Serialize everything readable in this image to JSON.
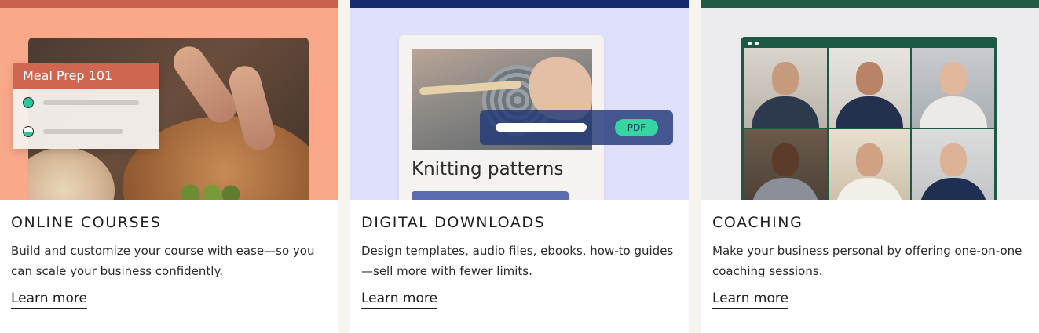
{
  "cards": [
    {
      "title": "ONLINE COURSES",
      "description_line1": "Build and customize your course with ease—so you",
      "description_line2": "can scale your business confidently.",
      "link": "Learn more",
      "accent": "#c8624d",
      "bg": "#f9a98a",
      "overlay": {
        "heading": "Meal Prep 101"
      }
    },
    {
      "title": "DIGITAL DOWNLOADS",
      "description_line1": "Design templates, audio files, ebooks, how-to guides",
      "description_line2": "—sell more with fewer limits.",
      "link": "Learn more",
      "accent": "#152b6e",
      "bg": "#dfe0fb",
      "overlay": {
        "doc_title": "Knitting patterns",
        "badge": "PDF"
      }
    },
    {
      "title": "COACHING",
      "description_line1": "Make your business personal by offering one-on-one",
      "description_line2": "coaching sessions.",
      "link": "Learn more",
      "accent": "#1f5b43",
      "bg": "#ececef"
    }
  ]
}
